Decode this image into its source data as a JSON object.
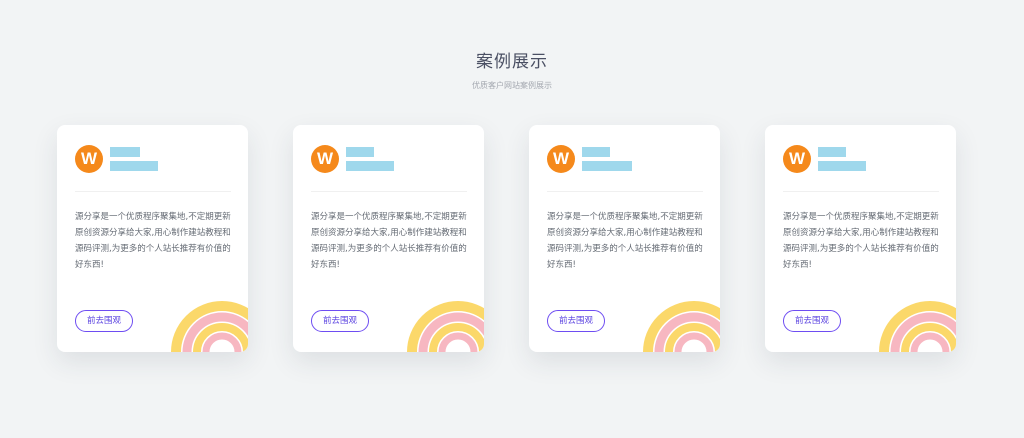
{
  "header": {
    "title": "案例展示",
    "subtitle": "优质客户网站案例展示"
  },
  "cards": [
    {
      "logo_letter": "W",
      "name": "",
      "link": "",
      "description": "源分享是一个优质程序聚集地,不定期更新原创资源分享给大家,用心制作建站教程和源码评测,为更多的个人站长推荐有价值的好东西!",
      "button_label": "前去围观"
    },
    {
      "logo_letter": "W",
      "name": "",
      "link": "",
      "description": "源分享是一个优质程序聚集地,不定期更新原创资源分享给大家,用心制作建站教程和源码评测,为更多的个人站长推荐有价值的好东西!",
      "button_label": "前去围观"
    },
    {
      "logo_letter": "W",
      "name": "",
      "link": "",
      "description": "源分享是一个优质程序聚集地,不定期更新原创资源分享给大家,用心制作建站教程和源码评测,为更多的个人站长推荐有价值的好东西!",
      "button_label": "前去围观"
    },
    {
      "logo_letter": "W",
      "name": "",
      "link": "",
      "description": "源分享是一个优质程序聚集地,不定期更新原创资源分享给大家,用心制作建站教程和源码评测,为更多的个人站长推荐有价值的好东西!",
      "button_label": "前去围观"
    }
  ],
  "colors": {
    "page_background": "#f2f4f5",
    "card_background": "#ffffff",
    "logo_background": "#f5891b",
    "redacted_block": "#9fd8ec",
    "button_accent": "#6e4df2",
    "rainbow_outer": "#fbd86a",
    "rainbow_middle": "#f7b7c1",
    "rainbow_inner": "#fbd86a"
  }
}
